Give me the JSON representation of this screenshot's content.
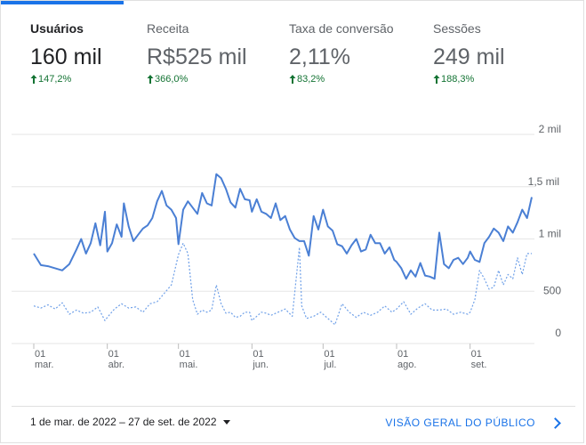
{
  "metrics": [
    {
      "label": "Usuários",
      "value": "160 mil",
      "delta": "147,2%",
      "active": true
    },
    {
      "label": "Receita",
      "value": "R$525 mil",
      "delta": "366,0%",
      "active": false
    },
    {
      "label": "Taxa de conversão",
      "value": "2,11%",
      "delta": "83,2%",
      "active": false
    },
    {
      "label": "Sessões",
      "value": "249 mil",
      "delta": "188,3%",
      "active": false
    }
  ],
  "colors": {
    "accent": "#1a73e8",
    "positive": "#137333",
    "grid": "#e6e6e6",
    "primary_series": "#4a7fd4",
    "comparison_series": "#6fa0e8"
  },
  "footer": {
    "date_range": "1 de mar. de 2022 – 27 de set. de 2022",
    "audience_link": "VISÃO GERAL DO PÚBLICO"
  },
  "chart_data": {
    "type": "line",
    "y_ticks": [
      "2 mil",
      "1,5 mil",
      "1 mil",
      "500",
      "0"
    ],
    "y_tick_values": [
      2000,
      1500,
      1000,
      500,
      0
    ],
    "ylim": [
      0,
      2000
    ],
    "y_axis_position": "right",
    "x_ticks": [
      {
        "day": "01",
        "month": "mar.",
        "index": 0
      },
      {
        "day": "01",
        "month": "abr.",
        "index": 31
      },
      {
        "day": "01",
        "month": "mai.",
        "index": 61
      },
      {
        "day": "01",
        "month": "jun.",
        "index": 92
      },
      {
        "day": "01",
        "month": "jul.",
        "index": 122
      },
      {
        "day": "01",
        "month": "ago.",
        "index": 153
      },
      {
        "day": "01",
        "month": "set.",
        "index": 184
      }
    ],
    "x_range_days": 210,
    "grid": true,
    "series": [
      {
        "style": "solid",
        "points": [
          [
            0,
            860
          ],
          [
            3,
            750
          ],
          [
            6,
            740
          ],
          [
            9,
            720
          ],
          [
            12,
            700
          ],
          [
            15,
            760
          ],
          [
            18,
            900
          ],
          [
            20,
            1000
          ],
          [
            22,
            860
          ],
          [
            24,
            960
          ],
          [
            26,
            1150
          ],
          [
            28,
            940
          ],
          [
            30,
            1260
          ],
          [
            31,
            880
          ],
          [
            33,
            960
          ],
          [
            35,
            1140
          ],
          [
            37,
            1020
          ],
          [
            38,
            1340
          ],
          [
            40,
            1120
          ],
          [
            42,
            980
          ],
          [
            44,
            1040
          ],
          [
            46,
            1100
          ],
          [
            48,
            1130
          ],
          [
            50,
            1200
          ],
          [
            52,
            1360
          ],
          [
            54,
            1460
          ],
          [
            56,
            1320
          ],
          [
            58,
            1280
          ],
          [
            60,
            1200
          ],
          [
            61,
            950
          ],
          [
            63,
            1280
          ],
          [
            65,
            1360
          ],
          [
            67,
            1300
          ],
          [
            69,
            1240
          ],
          [
            71,
            1440
          ],
          [
            73,
            1340
          ],
          [
            75,
            1320
          ],
          [
            77,
            1620
          ],
          [
            79,
            1580
          ],
          [
            81,
            1480
          ],
          [
            83,
            1350
          ],
          [
            85,
            1300
          ],
          [
            87,
            1480
          ],
          [
            89,
            1380
          ],
          [
            91,
            1370
          ],
          [
            92,
            1260
          ],
          [
            94,
            1380
          ],
          [
            96,
            1260
          ],
          [
            98,
            1240
          ],
          [
            100,
            1200
          ],
          [
            102,
            1340
          ],
          [
            104,
            1180
          ],
          [
            106,
            1220
          ],
          [
            108,
            1090
          ],
          [
            110,
            1010
          ],
          [
            112,
            980
          ],
          [
            114,
            980
          ],
          [
            116,
            840
          ],
          [
            118,
            1220
          ],
          [
            120,
            1090
          ],
          [
            122,
            1280
          ],
          [
            124,
            1120
          ],
          [
            126,
            1080
          ],
          [
            128,
            950
          ],
          [
            130,
            930
          ],
          [
            132,
            860
          ],
          [
            134,
            940
          ],
          [
            136,
            1000
          ],
          [
            138,
            880
          ],
          [
            140,
            900
          ],
          [
            142,
            1040
          ],
          [
            144,
            960
          ],
          [
            146,
            960
          ],
          [
            148,
            860
          ],
          [
            150,
            920
          ],
          [
            152,
            800
          ],
          [
            153,
            780
          ],
          [
            155,
            720
          ],
          [
            157,
            620
          ],
          [
            159,
            700
          ],
          [
            161,
            640
          ],
          [
            163,
            770
          ],
          [
            165,
            650
          ],
          [
            167,
            640
          ],
          [
            169,
            620
          ],
          [
            171,
            1060
          ],
          [
            173,
            760
          ],
          [
            175,
            720
          ],
          [
            177,
            800
          ],
          [
            179,
            820
          ],
          [
            181,
            760
          ],
          [
            183,
            820
          ],
          [
            184,
            880
          ],
          [
            186,
            800
          ],
          [
            188,
            780
          ],
          [
            190,
            960
          ],
          [
            192,
            1020
          ],
          [
            194,
            1100
          ],
          [
            196,
            1060
          ],
          [
            198,
            980
          ],
          [
            200,
            1120
          ],
          [
            202,
            1060
          ],
          [
            204,
            1160
          ],
          [
            206,
            1280
          ],
          [
            208,
            1200
          ],
          [
            210,
            1400
          ]
        ]
      },
      {
        "style": "dashed",
        "points": [
          [
            0,
            360
          ],
          [
            3,
            340
          ],
          [
            6,
            370
          ],
          [
            9,
            330
          ],
          [
            12,
            390
          ],
          [
            15,
            280
          ],
          [
            18,
            320
          ],
          [
            21,
            290
          ],
          [
            24,
            300
          ],
          [
            27,
            350
          ],
          [
            30,
            220
          ],
          [
            31,
            250
          ],
          [
            34,
            330
          ],
          [
            37,
            380
          ],
          [
            40,
            340
          ],
          [
            43,
            350
          ],
          [
            46,
            300
          ],
          [
            49,
            380
          ],
          [
            52,
            400
          ],
          [
            55,
            480
          ],
          [
            58,
            560
          ],
          [
            61,
            850
          ],
          [
            63,
            960
          ],
          [
            65,
            860
          ],
          [
            67,
            420
          ],
          [
            69,
            280
          ],
          [
            71,
            320
          ],
          [
            73,
            300
          ],
          [
            75,
            320
          ],
          [
            77,
            560
          ],
          [
            79,
            380
          ],
          [
            81,
            290
          ],
          [
            83,
            300
          ],
          [
            85,
            250
          ],
          [
            87,
            260
          ],
          [
            89,
            300
          ],
          [
            91,
            300
          ],
          [
            92,
            220
          ],
          [
            94,
            260
          ],
          [
            96,
            300
          ],
          [
            98,
            290
          ],
          [
            100,
            270
          ],
          [
            103,
            300
          ],
          [
            106,
            330
          ],
          [
            109,
            260
          ],
          [
            112,
            920
          ],
          [
            113,
            360
          ],
          [
            115,
            240
          ],
          [
            118,
            260
          ],
          [
            121,
            300
          ],
          [
            124,
            240
          ],
          [
            127,
            180
          ],
          [
            130,
            380
          ],
          [
            133,
            300
          ],
          [
            136,
            250
          ],
          [
            139,
            300
          ],
          [
            142,
            270
          ],
          [
            145,
            300
          ],
          [
            148,
            360
          ],
          [
            151,
            300
          ],
          [
            153,
            330
          ],
          [
            156,
            400
          ],
          [
            159,
            280
          ],
          [
            162,
            340
          ],
          [
            165,
            380
          ],
          [
            168,
            320
          ],
          [
            171,
            320
          ],
          [
            174,
            330
          ],
          [
            177,
            280
          ],
          [
            180,
            300
          ],
          [
            183,
            280
          ],
          [
            184,
            300
          ],
          [
            186,
            420
          ],
          [
            188,
            700
          ],
          [
            190,
            620
          ],
          [
            192,
            520
          ],
          [
            194,
            540
          ],
          [
            196,
            700
          ],
          [
            198,
            560
          ],
          [
            200,
            660
          ],
          [
            202,
            620
          ],
          [
            204,
            820
          ],
          [
            206,
            660
          ],
          [
            208,
            860
          ],
          [
            210,
            860
          ]
        ]
      }
    ]
  }
}
